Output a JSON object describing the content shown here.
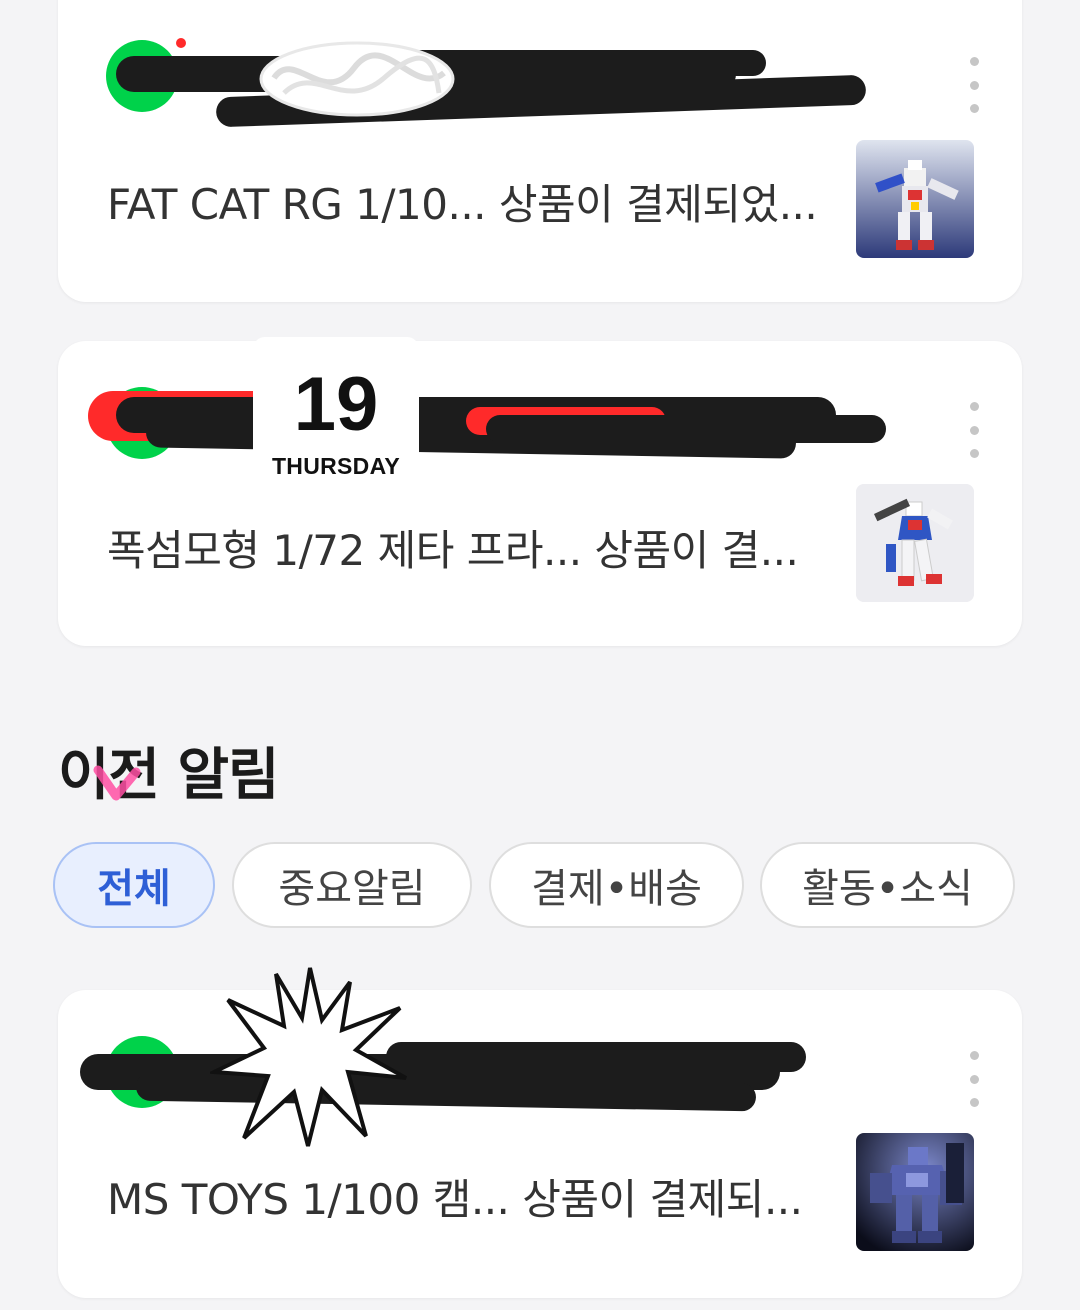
{
  "notifications_top": [
    {
      "text": "FAT CAT RG 1/10... 상품이 결제되었...",
      "thumbnail_icon": "gundam-thumbnail",
      "avatar_color": "#00c853"
    },
    {
      "text": "폭섬모형 1/72 제타 프라... 상품이 결...",
      "thumbnail_icon": "zeta-gundam-thumbnail",
      "avatar_color": "#00c853"
    }
  ],
  "date_sticker": {
    "day": "19",
    "weekday": "THURSDAY"
  },
  "section": {
    "title": "이전 알림"
  },
  "filters": {
    "chips": [
      {
        "label": "전체",
        "active": true
      },
      {
        "label": "중요알림",
        "active": false
      },
      {
        "label": "결제•배송",
        "active": false
      },
      {
        "label": "활동•소식",
        "active": false
      }
    ]
  },
  "notifications_previous": [
    {
      "text": "MS TOYS 1/100 캠... 상품이 결제되...",
      "thumbnail_icon": "mech-robot-thumbnail",
      "avatar_color": "#00c853"
    }
  ],
  "colors": {
    "background": "#f4f4f6",
    "card": "#ffffff",
    "chip_active_bg": "#e8effe",
    "chip_active_text": "#2e5fd6",
    "redaction": "#1c1c1c",
    "redaction_red": "#ff2a2a"
  }
}
